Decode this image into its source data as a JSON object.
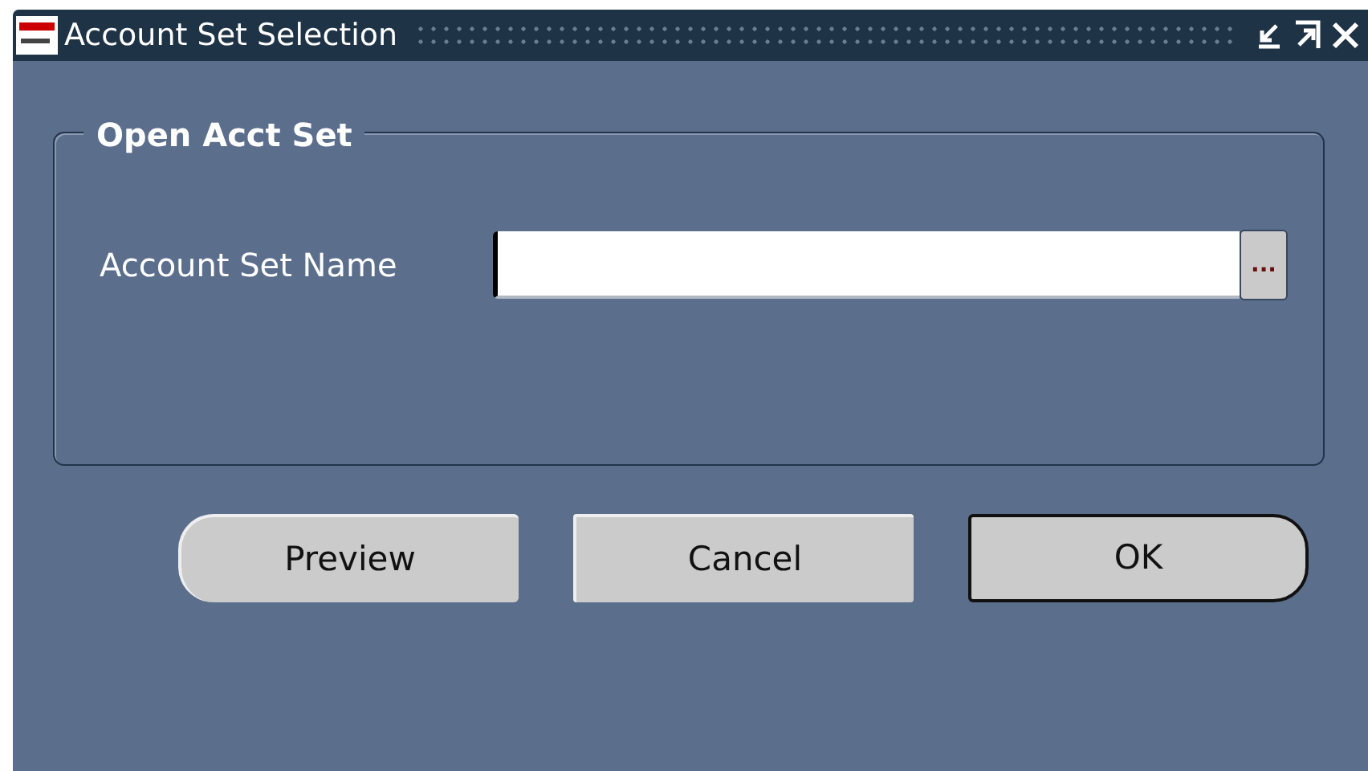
{
  "window": {
    "title": "Account Set Selection"
  },
  "group": {
    "legend": "Open Acct Set",
    "field": {
      "label": "Account Set Name",
      "focused": true,
      "lov_button": "..."
    }
  },
  "buttons": [
    {
      "label": "Preview",
      "kind": "left",
      "default": false
    },
    {
      "label": "Cancel",
      "kind": "square",
      "default": false
    },
    {
      "label": "OK",
      "kind": "right",
      "default": true
    }
  ]
}
